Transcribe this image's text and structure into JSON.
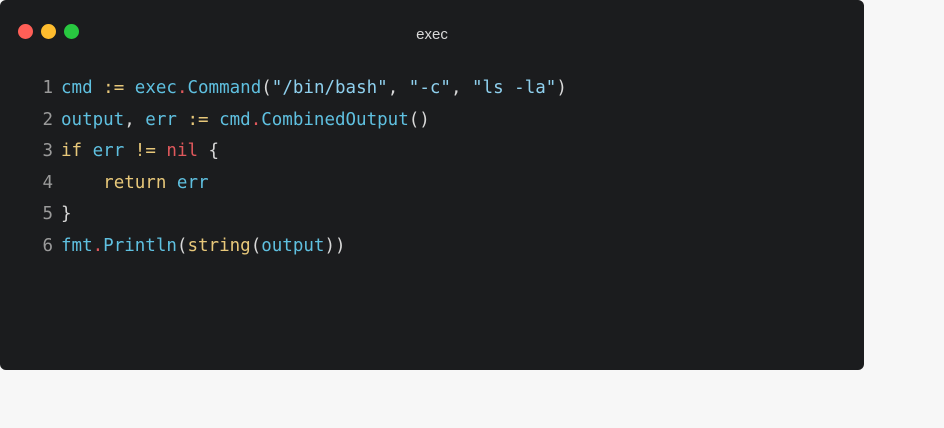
{
  "window": {
    "title": "exec",
    "buttons": {
      "close_color": "#ff5f57",
      "minimize_color": "#febc2e",
      "zoom_color": "#28c840"
    }
  },
  "code_colors": {
    "plain": "#5fc0e0",
    "keyword": "#e8c87a",
    "operator": "#e8c87a",
    "dot": "#e0585c",
    "function": "#5fc0e0",
    "string": "#8fd0ee",
    "punct": "#d8d8d8",
    "nil": "#e0585c"
  },
  "code": {
    "lines": [
      {
        "number": "1",
        "tokens": [
          {
            "text": "cmd",
            "type": "plain"
          },
          {
            "text": " ",
            "type": "punct"
          },
          {
            "text": ":=",
            "type": "operator"
          },
          {
            "text": " ",
            "type": "punct"
          },
          {
            "text": "exec",
            "type": "plain"
          },
          {
            "text": ".",
            "type": "dot"
          },
          {
            "text": "Command",
            "type": "function"
          },
          {
            "text": "(",
            "type": "punct"
          },
          {
            "text": "\"/bin/bash\"",
            "type": "string"
          },
          {
            "text": ", ",
            "type": "punct"
          },
          {
            "text": "\"-c\"",
            "type": "string"
          },
          {
            "text": ", ",
            "type": "punct"
          },
          {
            "text": "\"ls -la\"",
            "type": "string"
          },
          {
            "text": ")",
            "type": "punct"
          }
        ]
      },
      {
        "number": "2",
        "tokens": [
          {
            "text": "output",
            "type": "plain"
          },
          {
            "text": ", ",
            "type": "punct"
          },
          {
            "text": "err",
            "type": "plain"
          },
          {
            "text": " ",
            "type": "punct"
          },
          {
            "text": ":=",
            "type": "operator"
          },
          {
            "text": " ",
            "type": "punct"
          },
          {
            "text": "cmd",
            "type": "plain"
          },
          {
            "text": ".",
            "type": "dot"
          },
          {
            "text": "CombinedOutput",
            "type": "function"
          },
          {
            "text": "()",
            "type": "punct"
          }
        ]
      },
      {
        "number": "3",
        "tokens": [
          {
            "text": "if",
            "type": "keyword"
          },
          {
            "text": " ",
            "type": "punct"
          },
          {
            "text": "err",
            "type": "plain"
          },
          {
            "text": " ",
            "type": "punct"
          },
          {
            "text": "!=",
            "type": "operator"
          },
          {
            "text": " ",
            "type": "punct"
          },
          {
            "text": "nil",
            "type": "nil"
          },
          {
            "text": " {",
            "type": "punct"
          }
        ]
      },
      {
        "number": "4",
        "tokens": [
          {
            "text": "    ",
            "type": "punct"
          },
          {
            "text": "return",
            "type": "keyword"
          },
          {
            "text": " ",
            "type": "punct"
          },
          {
            "text": "err",
            "type": "plain"
          }
        ]
      },
      {
        "number": "5",
        "tokens": [
          {
            "text": "}",
            "type": "punct"
          }
        ]
      },
      {
        "number": "6",
        "tokens": [
          {
            "text": "fmt",
            "type": "plain"
          },
          {
            "text": ".",
            "type": "dot"
          },
          {
            "text": "Println",
            "type": "function"
          },
          {
            "text": "(",
            "type": "punct"
          },
          {
            "text": "string",
            "type": "keyword"
          },
          {
            "text": "(",
            "type": "punct"
          },
          {
            "text": "output",
            "type": "plain"
          },
          {
            "text": "))",
            "type": "punct"
          }
        ]
      }
    ]
  }
}
